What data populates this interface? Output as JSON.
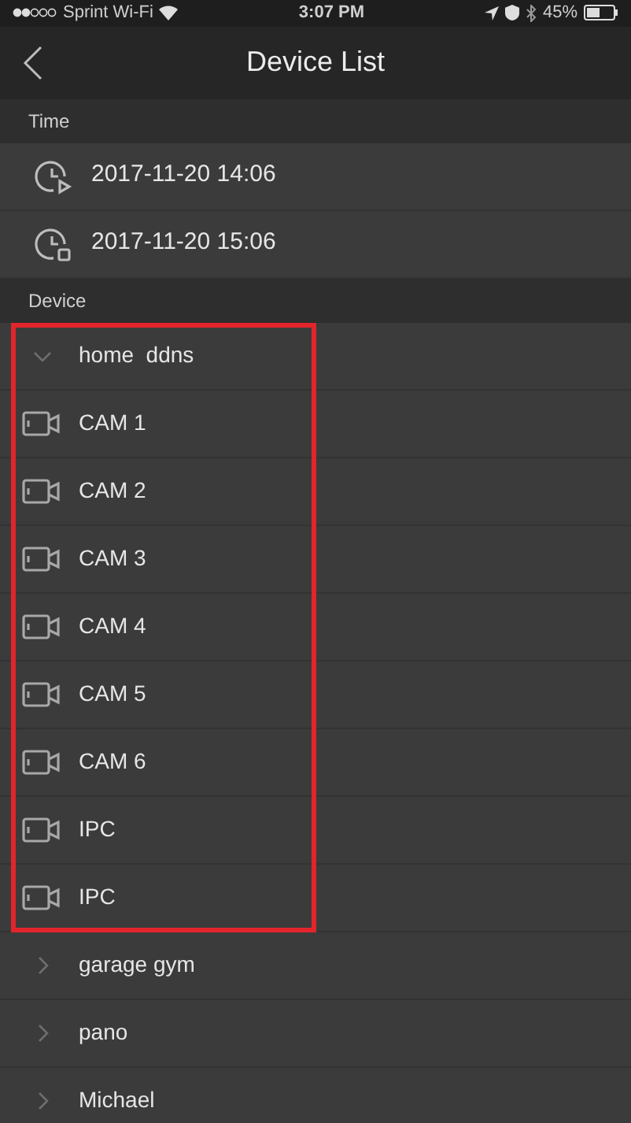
{
  "status_bar": {
    "carrier": "Sprint Wi-Fi",
    "time": "3:07 PM",
    "battery": "45%"
  },
  "nav_bar": {
    "title": "Device List"
  },
  "time_section": {
    "header": "Time",
    "rows": [
      {
        "kind": "start",
        "text": "2017-11-20 14:06"
      },
      {
        "kind": "end",
        "text": "2017-11-20 15:06"
      }
    ]
  },
  "device_section": {
    "header": "Device",
    "devices": [
      {
        "name": "home  ddns",
        "expanded": true,
        "highlighted": true,
        "children": [
          {
            "name": "CAM 1"
          },
          {
            "name": "CAM 2"
          },
          {
            "name": "CAM 3"
          },
          {
            "name": "CAM 4"
          },
          {
            "name": "CAM 5"
          },
          {
            "name": "CAM 6"
          },
          {
            "name": "IPC"
          },
          {
            "name": "IPC"
          }
        ]
      },
      {
        "name": "garage gym",
        "expanded": false,
        "highlighted": false
      },
      {
        "name": "pano",
        "expanded": false,
        "highlighted": false
      },
      {
        "name": "Michael",
        "expanded": false,
        "highlighted": false
      }
    ]
  }
}
